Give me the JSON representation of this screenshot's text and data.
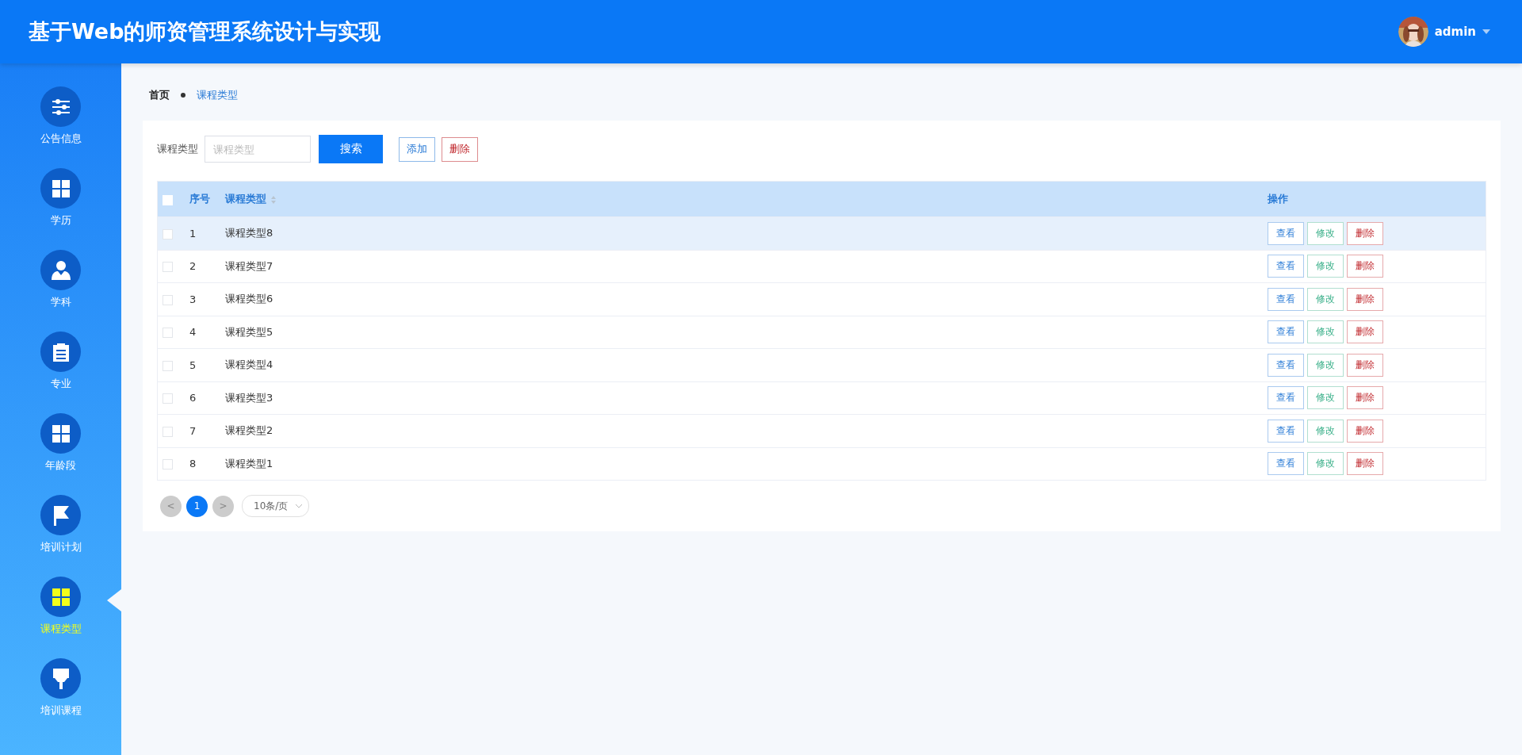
{
  "header": {
    "title": "基于Web的师资管理系统设计与实现",
    "user": "admin"
  },
  "sidebar": {
    "items": [
      {
        "label": "公告信息",
        "kind": "sliders",
        "selected": false
      },
      {
        "label": "学历",
        "kind": "grid",
        "selected": false
      },
      {
        "label": "学科",
        "kind": "user",
        "selected": false
      },
      {
        "label": "专业",
        "kind": "clipboard",
        "selected": false
      },
      {
        "label": "年龄段",
        "kind": "grid",
        "selected": false
      },
      {
        "label": "培训计划",
        "kind": "flag",
        "selected": false
      },
      {
        "label": "课程类型",
        "kind": "grid",
        "selected": true
      },
      {
        "label": "培训课程",
        "kind": "brush",
        "selected": false
      }
    ]
  },
  "breadcrumb": [
    "首页",
    "课程类型"
  ],
  "search": {
    "label": "课程类型",
    "placeholder": "课程类型",
    "button": "搜索",
    "add": "添加",
    "delete": "删除"
  },
  "table": {
    "select_all_checked": false,
    "columns": [
      "序号",
      "课程类型",
      "操作"
    ],
    "rows": [
      {
        "index": "1",
        "name": "课程类型8",
        "hovered": true,
        "actions": [
          "查看",
          "修改",
          "删除"
        ]
      },
      {
        "index": "2",
        "name": "课程类型7",
        "hovered": false,
        "actions": [
          "查看",
          "修改",
          "删除"
        ]
      },
      {
        "index": "3",
        "name": "课程类型6",
        "hovered": false,
        "actions": [
          "查看",
          "修改",
          "删除"
        ]
      },
      {
        "index": "4",
        "name": "课程类型5",
        "hovered": false,
        "actions": [
          "查看",
          "修改",
          "删除"
        ]
      },
      {
        "index": "5",
        "name": "课程类型4",
        "hovered": false,
        "actions": [
          "查看",
          "修改",
          "删除"
        ]
      },
      {
        "index": "6",
        "name": "课程类型3",
        "hovered": false,
        "actions": [
          "查看",
          "修改",
          "删除"
        ]
      },
      {
        "index": "7",
        "name": "课程类型2",
        "hovered": false,
        "actions": [
          "查看",
          "修改",
          "删除"
        ]
      },
      {
        "index": "8",
        "name": "课程类型1",
        "hovered": false,
        "actions": [
          "查看",
          "修改",
          "删除"
        ]
      }
    ]
  },
  "pagination": {
    "prev": "<",
    "pages": [
      {
        "label": "1",
        "selected": true
      }
    ],
    "next": ">",
    "page_size": "10条/页"
  }
}
